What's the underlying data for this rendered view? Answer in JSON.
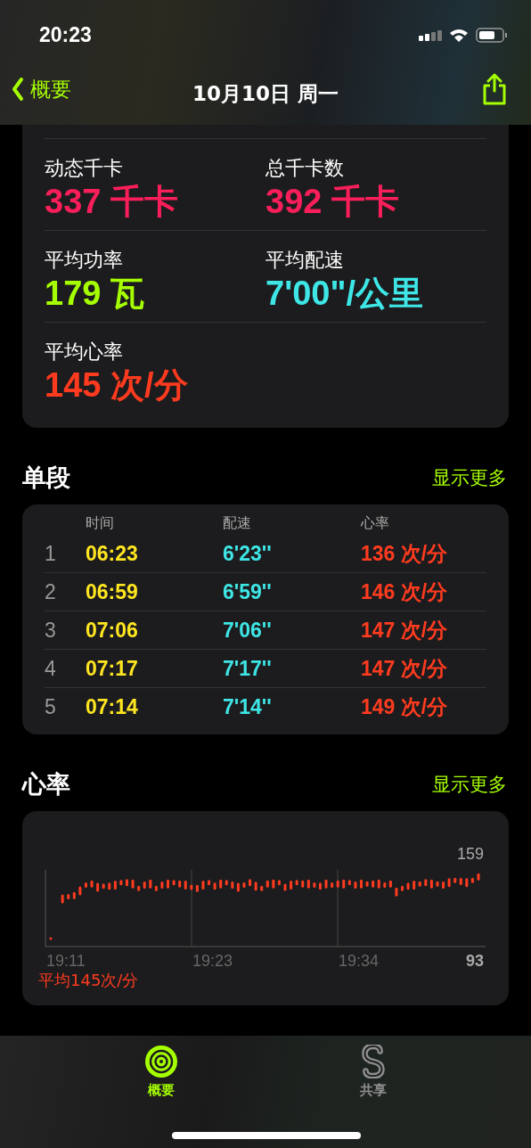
{
  "status_bar": {
    "time": "20:23"
  },
  "nav": {
    "back_label": "概要",
    "title": "10月10日 周一"
  },
  "metrics": [
    {
      "label": "动态千卡",
      "value": "337 千卡",
      "color": "#fa1e5a"
    },
    {
      "label": "总千卡数",
      "value": "392 千卡",
      "color": "#fa1e5a"
    },
    {
      "label": "平均功率",
      "value": "179 瓦",
      "color": "#a6ff00"
    },
    {
      "label": "平均配速",
      "value": "7'00\"/公里",
      "color": "#3ee6e6"
    },
    {
      "label": "平均心率",
      "value": "145 次/分",
      "color": "#ff3b1f"
    }
  ],
  "splits": {
    "title": "单段",
    "more": "显示更多",
    "columns": [
      "时间",
      "配速",
      "心率"
    ],
    "rows": [
      {
        "index": "1",
        "time": "06:23",
        "pace": "6'23''",
        "heart_rate": "136 次/分"
      },
      {
        "index": "2",
        "time": "06:59",
        "pace": "6'59''",
        "heart_rate": "146 次/分"
      },
      {
        "index": "3",
        "time": "07:06",
        "pace": "7'06''",
        "heart_rate": "147 次/分"
      },
      {
        "index": "4",
        "time": "07:17",
        "pace": "7'17''",
        "heart_rate": "147 次/分"
      },
      {
        "index": "5",
        "time": "07:14",
        "pace": "7'14''",
        "heart_rate": "149 次/分"
      }
    ]
  },
  "heart_rate": {
    "title": "心率",
    "more": "显示更多",
    "average": "平均145次/分",
    "max_label": "159",
    "min_label": "93",
    "time_labels": [
      "19:11",
      "19:23",
      "19:34"
    ]
  },
  "tab_bar": [
    {
      "label": "概要",
      "selected": true,
      "kind": "activity"
    },
    {
      "label": "共享",
      "selected": false,
      "kind": "sharing"
    }
  ]
}
